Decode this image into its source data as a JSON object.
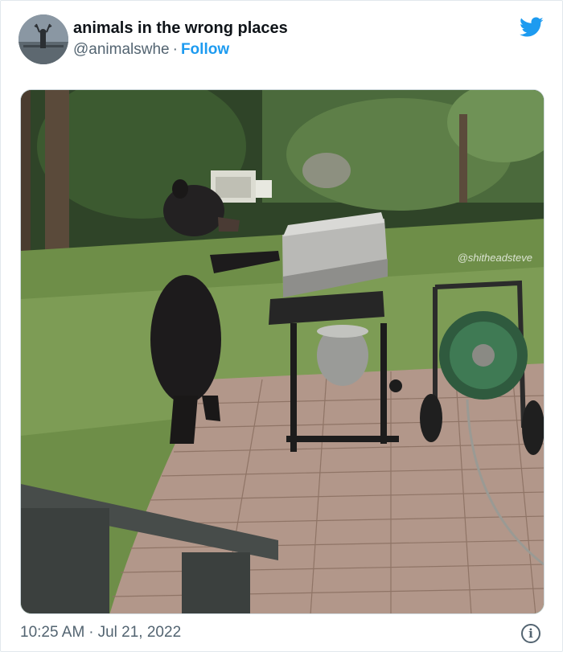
{
  "tweet": {
    "display_name": "animals in the wrong places",
    "handle": "@animalswhe",
    "separator": "·",
    "follow_label": "Follow",
    "brand_icon": "twitter-bird-icon",
    "brand_color": "#1d9bf0"
  },
  "media": {
    "watermark": "@shitheadsteve"
  },
  "footer": {
    "time": "10:25 AM",
    "separator": "·",
    "date": "Jul 21, 2022",
    "info_icon_glyph": "i"
  }
}
